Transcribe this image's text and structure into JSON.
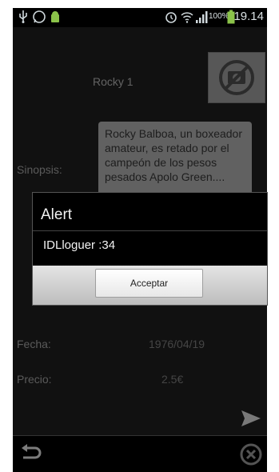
{
  "status_bar": {
    "battery_percent": "100%",
    "time": "19.14"
  },
  "detail": {
    "movie_title": "Rocky 1",
    "synopsis_label": "Sinopsis:",
    "synopsis_text": "Rocky Balboa, un boxeador amateur, es retado por el campeón de los pesos pesados Apolo Green....",
    "date_label": "Fecha:",
    "date_value": "1976/04/19",
    "price_label": "Precio:",
    "price_value": "2.5€"
  },
  "alert": {
    "title": "Alert",
    "message": "IDLloguer :34",
    "accept_button": "Acceptar"
  },
  "icons": {
    "poster": "no-camera-icon",
    "send": "send-icon",
    "back": "back-icon",
    "cancel": "cancel-icon"
  },
  "colors": {
    "battery_green": "#8bc34a",
    "dialog_bg": "#000000",
    "synopsis_bg": "#e2e2e2"
  }
}
